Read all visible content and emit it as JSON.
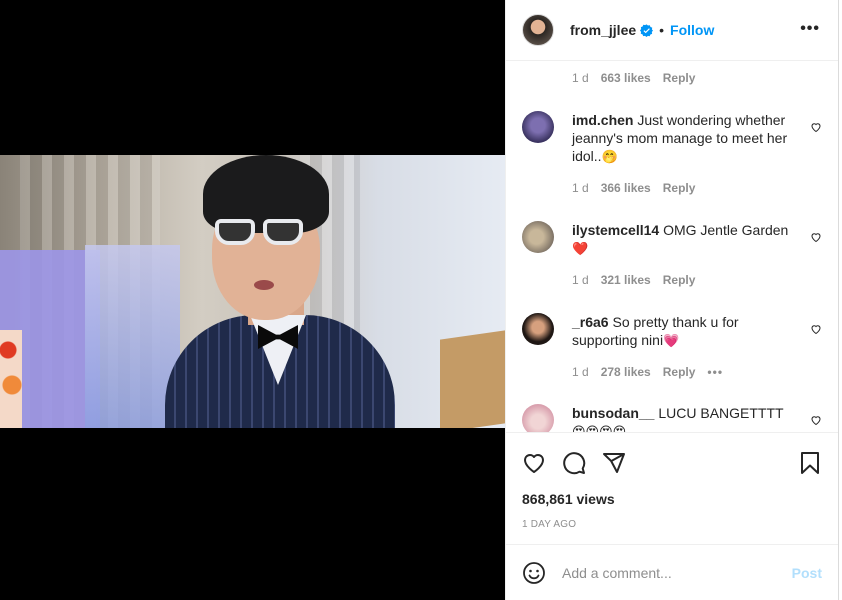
{
  "header": {
    "username": "from_jjlee",
    "separator": "•",
    "follow_label": "Follow",
    "more_label": "•••"
  },
  "comments": [
    {
      "username": "",
      "text": "",
      "time": "1 d",
      "likes": "663 likes",
      "reply": "Reply"
    },
    {
      "username": "imd.chen",
      "text": "Just wondering whether jeanny's mom manage to meet her idol..",
      "emoji": "🤭",
      "time": "1 d",
      "likes": "366 likes",
      "reply": "Reply"
    },
    {
      "username": "ilystemcell14",
      "text": "OMG Jentle Garden",
      "emoji": "❤️",
      "time": "1 d",
      "likes": "321 likes",
      "reply": "Reply"
    },
    {
      "username": "_r6a6",
      "text": "So pretty thank u for supporting nini",
      "emoji": "💗",
      "time": "1 d",
      "likes": "278 likes",
      "reply": "Reply",
      "more": "•••"
    },
    {
      "username": "bunsodan__",
      "text": "LUCU BANGETTTT",
      "emoji": "😍😍😍😍"
    }
  ],
  "stats": {
    "views": "868,861 views",
    "date": "1 DAY AGO"
  },
  "composer": {
    "placeholder": "Add a comment...",
    "post_label": "Post"
  },
  "icons": {
    "verified": "verified-badge-icon",
    "like": "heart-icon",
    "comment": "comment-bubble-icon",
    "share": "paper-plane-icon",
    "save": "bookmark-icon",
    "emoji": "smiley-icon"
  },
  "colors": {
    "accent": "#0095f6",
    "post_disabled": "#b2dffc",
    "muted": "#8e8e8e",
    "text": "#262626",
    "media_bg": "#000000"
  }
}
